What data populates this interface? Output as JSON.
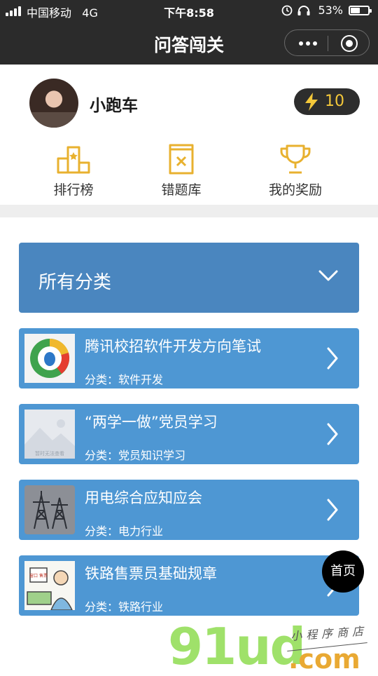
{
  "status_bar": {
    "carrier": "中国移动",
    "network": "4G",
    "time": "下午8:58",
    "battery": "53%",
    "battery_level": 0.53
  },
  "nav": {
    "title": "问答闯关"
  },
  "profile": {
    "username": "小跑车",
    "energy": "10"
  },
  "menu": [
    {
      "label": "排行榜",
      "icon": "ranking-podium-icon"
    },
    {
      "label": "错题库",
      "icon": "wrong-questions-icon"
    },
    {
      "label": "我的奖励",
      "icon": "trophy-icon"
    }
  ],
  "category_selector": {
    "label": "所有分类"
  },
  "quizzes": [
    {
      "title": "腾讯校招软件开发方向笔试",
      "category": "分类：软件开发",
      "thumb": "tencent-logo"
    },
    {
      "title": "“两学一做”党员学习",
      "category": "分类：党员知识学习",
      "thumb": "image-placeholder",
      "thumb_caption": "暂时无法查看"
    },
    {
      "title": "用电综合应知应会",
      "category": "分类：电力行业",
      "thumb": "power-tower"
    },
    {
      "title": "铁路售票员基础规章",
      "category": "分类：铁路行业",
      "thumb": "ticket-clerk-cartoon",
      "thumb_caption": "窗口 售票"
    }
  ],
  "fab": {
    "label": "首页"
  },
  "watermark": {
    "logo": "91ud",
    "domain": ".com",
    "tagline": "小程序商店"
  },
  "colors": {
    "accent_blue": "#4e97d3",
    "header_blue": "#4a86bf",
    "gold": "#f4c83a",
    "bar_dark": "#2b2b2b"
  }
}
